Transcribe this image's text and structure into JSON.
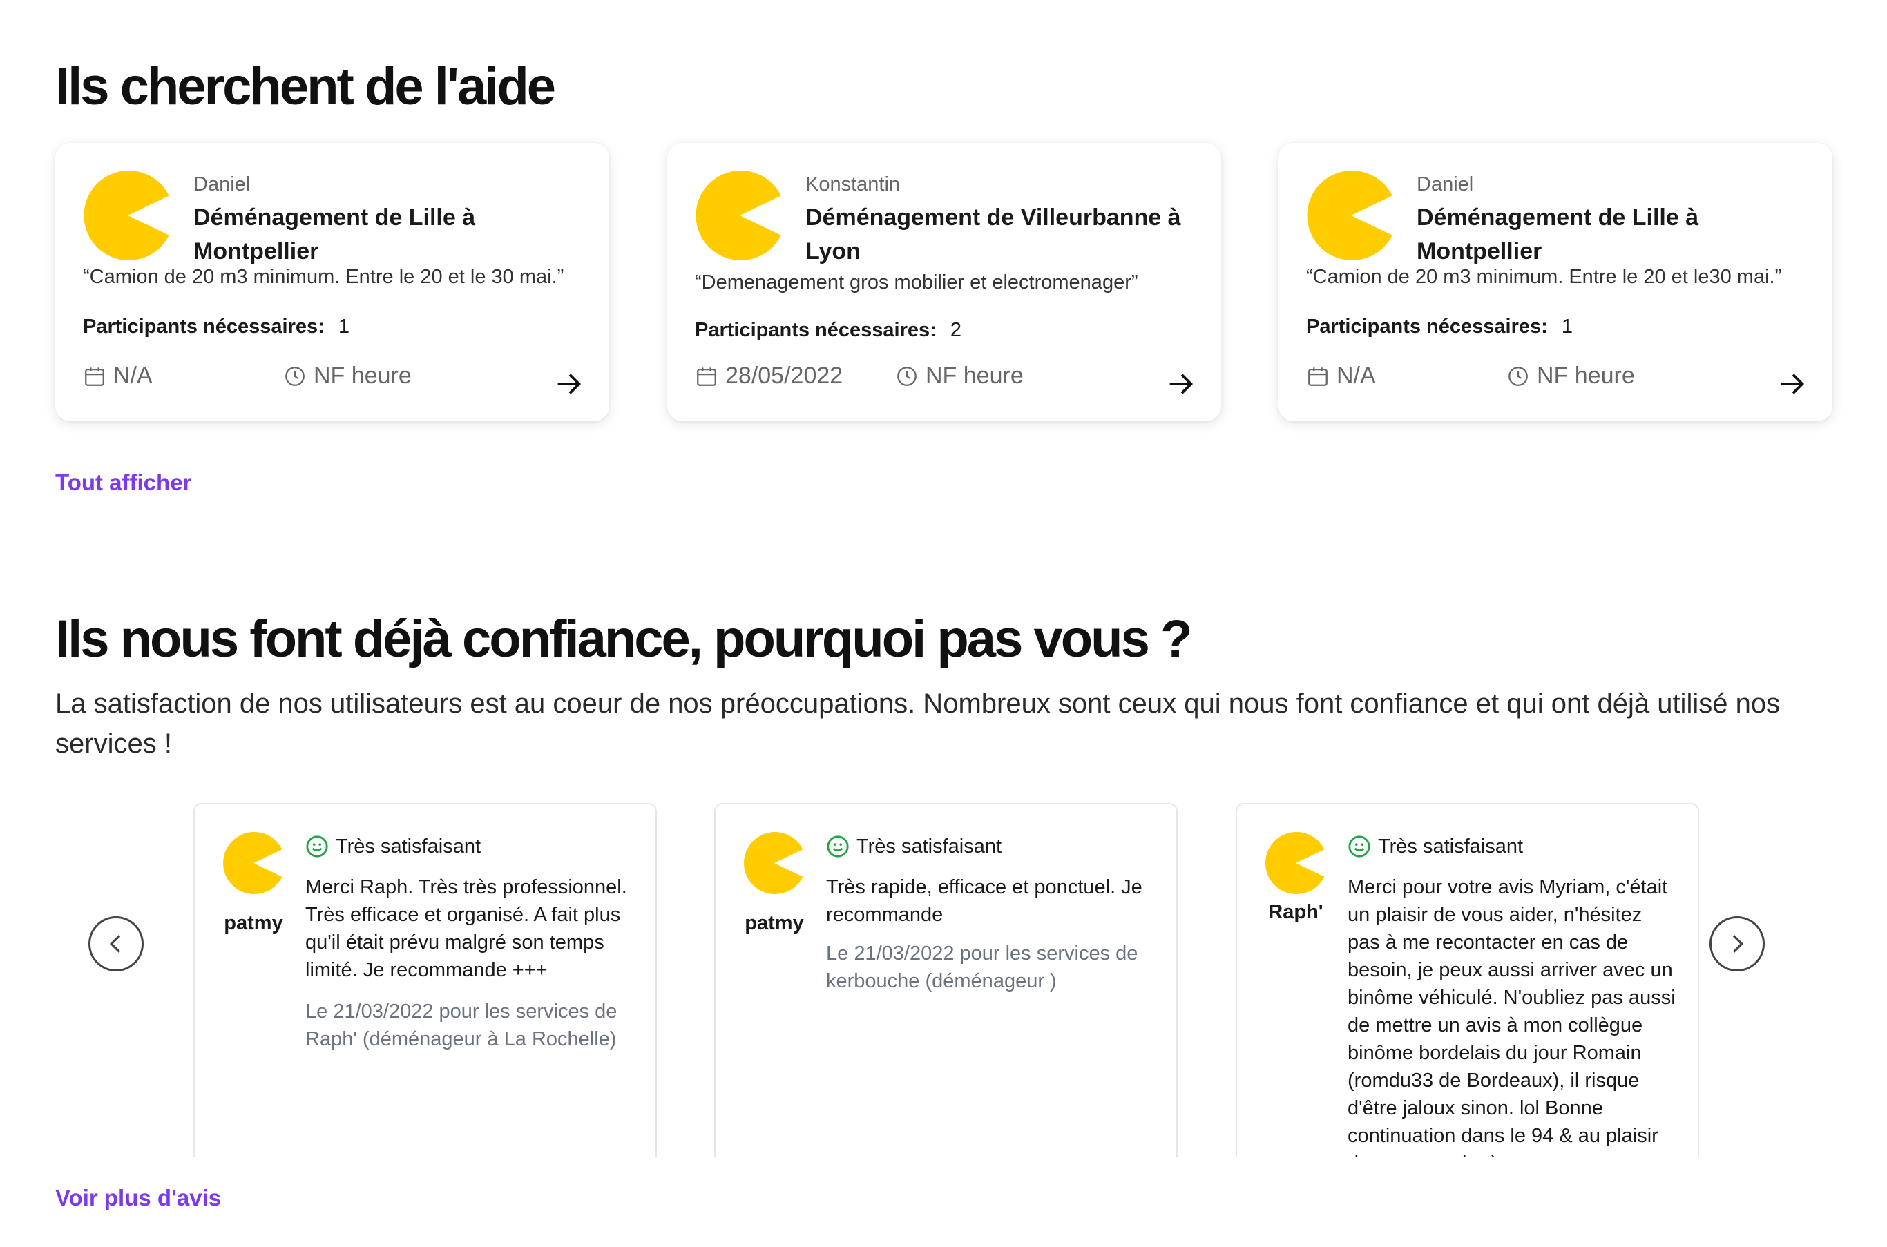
{
  "help_section": {
    "title": "Ils cherchent de l'aide",
    "see_all": "Tout afficher",
    "requests": [
      {
        "name": "Daniel",
        "title": "Déménagement de Lille à Montpellier",
        "quote": "“Camion de 20 m3 minimum. Entre le 20 et le 30 mai.”",
        "participants_label": "Participants nécessaires:",
        "participants_value": "1",
        "date": "N/A",
        "time": "NF heure"
      },
      {
        "name": "Konstantin",
        "title": "Déménagement de Villeurbanne à Lyon",
        "quote": "“Demenagement gros mobilier et electromenager”",
        "participants_label": "Participants nécessaires:",
        "participants_value": "2",
        "date": "28/05/2022",
        "time": "NF heure"
      },
      {
        "name": "Daniel",
        "title": "Déménagement de Lille à Montpellier",
        "quote": "“Camion de 20 m3 minimum. Entre le 20 et le30 mai.”",
        "participants_label": "Participants nécessaires:",
        "participants_value": "1",
        "date": "N/A",
        "time": "NF heure"
      }
    ]
  },
  "trust_section": {
    "title": "Ils nous font déjà confiance, pourquoi pas vous ?",
    "subtitle": "La satisfaction de nos utilisateurs est au coeur de nos préoccupations. Nombreux sont ceux qui nous font confiance et qui ont déjà utilisé nos services !",
    "more_reviews": "Voir plus d'avis",
    "reviews": [
      {
        "author": "patmy",
        "rating": "Très satisfaisant",
        "text": "Merci Raph. Très très professionnel. Très efficace et organisé. A fait plus qu'il était prévu malgré son temps limité. Je recommande +++",
        "meta": "Le 21/03/2022 pour les services de Raph' (déménageur à La Rochelle)"
      },
      {
        "author": "patmy",
        "rating": "Très satisfaisant",
        "text": "Très rapide, efficace et ponctuel. Je recommande",
        "meta": "Le 21/03/2022 pour les services de kerbouche (déménageur )"
      },
      {
        "author": "Raph'",
        "rating": "Très satisfaisant",
        "text": "Merci pour votre avis Myriam, c'était un plaisir de vous aider, n'hésitez pas à me recontacter en cas de besoin, je peux aussi arriver avec un binôme véhiculé. N'oubliez pas aussi de mettre un avis à mon collègue binôme bordelais du jour Romain (romdu33 de Bordeaux), il risque d'être jaloux sinon. lol Bonne continuation dans le 94 & au plaisir de vous revoir :-)",
        "meta": ""
      }
    ]
  },
  "colors": {
    "accent": "#7c3aed",
    "avatar": "#ffcc00",
    "rating_icon": "#22a447"
  },
  "icons": [
    "pacman-avatar-icon",
    "calendar-icon",
    "clock-icon",
    "arrow-right-icon",
    "smiley-icon",
    "chevron-left-icon",
    "chevron-right-icon"
  ]
}
